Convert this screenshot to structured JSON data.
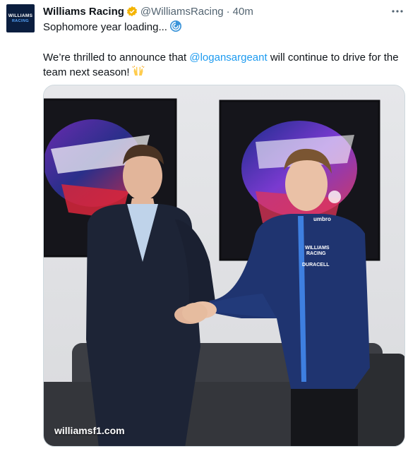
{
  "account": {
    "display_name": "Williams Racing",
    "handle": "@WilliamsRacing",
    "separator": "·",
    "time": "40m",
    "avatar_line1": "WILLIAMS",
    "avatar_line2": "RACING"
  },
  "tweet": {
    "line1": "Sophomore year loading...",
    "line2_prefix": "We’re thrilled to announce that ",
    "mention": "@logansargeant",
    "line2_suffix": " will continue to drive for the team next season!",
    "loading_emoji_icon": "cyclone-icon",
    "celebrate_emoji_icon": "raising-hands-icon"
  },
  "media": {
    "caption": "williamsf1.com",
    "jacket_text": [
      "umbro",
      "WILLIAMS",
      "RACING",
      "DURACELL"
    ]
  },
  "colors": {
    "link": "#1d9bf0",
    "verified_badge": "#f4b400",
    "muted": "#536471",
    "navy": "#0b1e3f"
  }
}
